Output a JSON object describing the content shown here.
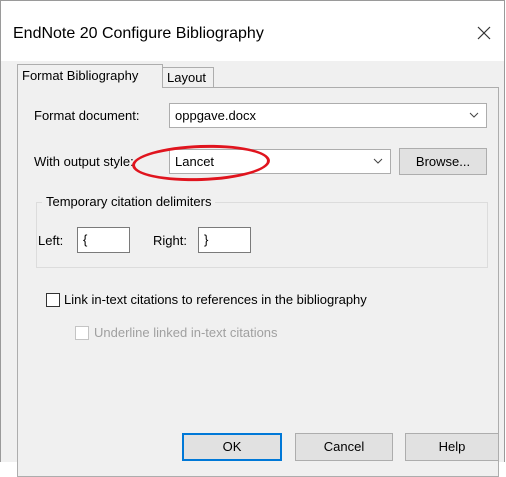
{
  "window": {
    "title": "EndNote 20 Configure Bibliography",
    "close_icon": "close-icon"
  },
  "tabs": [
    {
      "label": "Format Bibliography",
      "active": true
    },
    {
      "label": "Layout",
      "active": false
    }
  ],
  "format_document": {
    "label": "Format document:",
    "value": "oppgave.docx"
  },
  "output_style": {
    "label": "With output style:",
    "value": "Lancet",
    "browse_label": "Browse..."
  },
  "delimiters": {
    "group_label": "Temporary citation delimiters",
    "left_label": "Left:",
    "left_value": "{",
    "right_label": "Right:",
    "right_value": "}"
  },
  "options": {
    "link_label": "Link in-text citations to references in the bibliography",
    "link_checked": false,
    "underline_label": "Underline linked in-text citations",
    "underline_checked": false,
    "underline_enabled": false
  },
  "buttons": {
    "ok_label": "OK",
    "cancel_label": "Cancel",
    "help_label": "Help"
  },
  "colors": {
    "annotation": "#e0141e",
    "focus": "#0078d7"
  }
}
